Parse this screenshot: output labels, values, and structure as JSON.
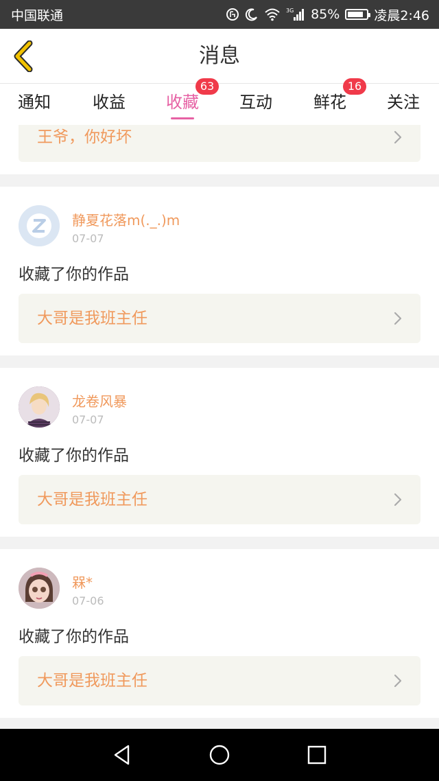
{
  "status_bar": {
    "carrier": "中国联通",
    "battery": "85%",
    "battery_level": 0.85,
    "time": "凌晨2:46",
    "network": "3G"
  },
  "header": {
    "title": "消息"
  },
  "tabs": [
    {
      "label": "通知",
      "active": false
    },
    {
      "label": "收益",
      "active": false
    },
    {
      "label": "收藏",
      "active": true,
      "badge": "63"
    },
    {
      "label": "互动",
      "active": false
    },
    {
      "label": "鲜花",
      "active": false,
      "badge": "16"
    },
    {
      "label": "关注",
      "active": false
    }
  ],
  "feed": {
    "partial_work_title": "王爷，你好坏",
    "items": [
      {
        "user": "静夏花落m(._.)m",
        "date": "07-07",
        "action": "收藏了你的作品",
        "work": "大哥是我班主任",
        "avatar": "qq-default-avatar"
      },
      {
        "user": "龙卷风暴",
        "date": "07-07",
        "action": "收藏了你的作品",
        "work": "大哥是我班主任",
        "avatar": "anime-boy-avatar"
      },
      {
        "user": "槑*",
        "date": "07-06",
        "action": "收藏了你的作品",
        "work": "大哥是我班主任",
        "avatar": "doll-girl-avatar"
      }
    ]
  },
  "colors": {
    "accent": "#e661a4",
    "link": "#f0995c",
    "badge": "#f03a4a",
    "back_arrow": "#f2c200"
  }
}
